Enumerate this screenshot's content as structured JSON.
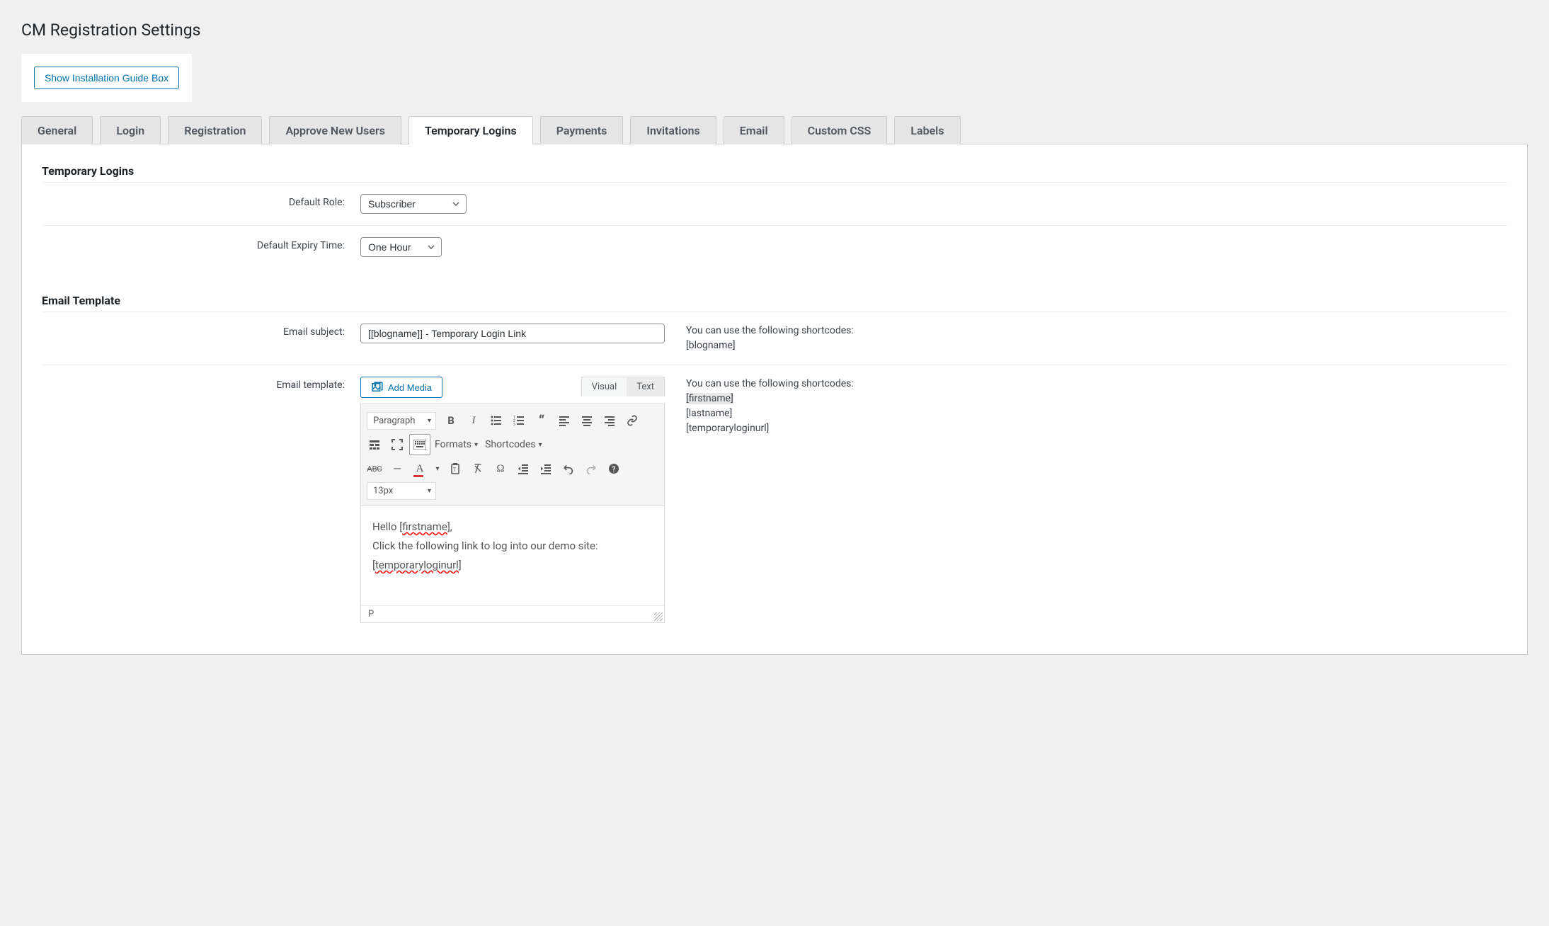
{
  "page_title": "CM Registration Settings",
  "show_install_btn": "Show Installation Guide Box",
  "tabs": [
    "General",
    "Login",
    "Registration",
    "Approve New Users",
    "Temporary Logins",
    "Payments",
    "Invitations",
    "Email",
    "Custom CSS",
    "Labels"
  ],
  "active_tab_index": 4,
  "sections": {
    "temp_logins": {
      "heading": "Temporary Logins",
      "default_role_label": "Default Role:",
      "default_role_value": "Subscriber",
      "default_expiry_label": "Default Expiry Time:",
      "default_expiry_value": "One Hour"
    },
    "email_template": {
      "heading": "Email Template",
      "subject_label": "Email subject:",
      "subject_value": "[[blogname]] - Temporary Login Link",
      "subject_help_intro": "You can use the following shortcodes:",
      "subject_shortcodes": [
        "[blogname]"
      ],
      "template_label": "Email template:",
      "add_media_label": "Add Media",
      "editor_tabs": [
        "Visual",
        "Text"
      ],
      "active_editor_tab": 1,
      "paragraph_select": "Paragraph",
      "formats_label": "Formats",
      "shortcodes_label": "Shortcodes",
      "fontsize_select": "13px",
      "body_line1_prefix": "Hello [",
      "body_line1_spell": "firstname",
      "body_line1_suffix": "],",
      "body_line2": "Click the following link to log into our demo site:",
      "body_line3_prefix": "[",
      "body_line3_spell": "temporaryloginurl",
      "body_line3_suffix": "]",
      "status_path": "P",
      "template_help_intro": "You can use the following shortcodes:",
      "template_shortcodes": [
        "[firstname]",
        "[lastname]",
        "[temporaryloginurl]"
      ]
    }
  }
}
